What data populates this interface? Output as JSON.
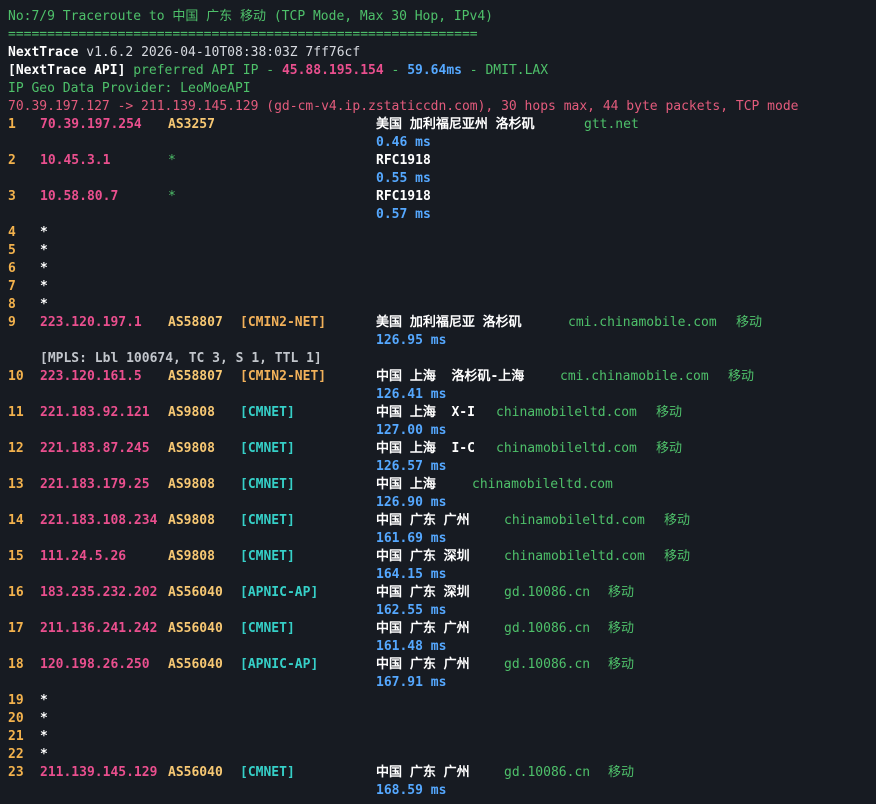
{
  "header": {
    "title": "No:7/9 Traceroute to 中国 广东 移动 (TCP Mode, Max 30 Hop, IPv4)",
    "separator": "============================================================",
    "app_name": "NextTrace",
    "version_info": " v1.6.2 2026-04-10T08:38:03Z 7ff76cf",
    "api_tag": "[NextTrace API]",
    "api_preferred_text": " preferred API IP - ",
    "api_ip": "45.88.195.154",
    "api_dash1": " - ",
    "api_latency": "59.64ms",
    "api_pop": " - DMIT.LAX",
    "geo_provider": "IP Geo Data Provider: LeoMoeAPI",
    "route_summary": "70.39.197.127 -> 211.139.145.129 (gd-cm-v4.ip.zstaticcdn.com), 30 hops max, 44 byte packets, TCP mode"
  },
  "hops": [
    {
      "num": "1",
      "ip": "70.39.197.254",
      "asn": "AS3257",
      "tag": "",
      "geo": "美国 加利福尼亚州 洛杉矶",
      "domain": "gtt.net",
      "isp": "",
      "rtt": "0.46 ms"
    },
    {
      "num": "2",
      "ip": "10.45.3.1",
      "asn": "*",
      "tag": "",
      "geo": "RFC1918",
      "domain": "",
      "isp": "",
      "rtt": "0.55 ms"
    },
    {
      "num": "3",
      "ip": "10.58.80.7",
      "asn": "*",
      "tag": "",
      "geo": "RFC1918",
      "domain": "",
      "isp": "",
      "rtt": "0.57 ms"
    },
    {
      "num": "4",
      "star": "*"
    },
    {
      "num": "5",
      "star": "*"
    },
    {
      "num": "6",
      "star": "*"
    },
    {
      "num": "7",
      "star": "*"
    },
    {
      "num": "8",
      "star": "*"
    },
    {
      "num": "9",
      "ip": "223.120.197.1",
      "asn": "AS58807",
      "tag": "[CMIN2-NET]",
      "geo": "美国 加利福尼亚 洛杉矶",
      "domain": "cmi.chinamobile.com",
      "isp": "移动",
      "rtt": "126.95 ms",
      "mpls": "[MPLS: Lbl 100674, TC 3, S 1, TTL 1]"
    },
    {
      "num": "10",
      "ip": "223.120.161.5",
      "asn": "AS58807",
      "tag": "[CMIN2-NET]",
      "geo": "中国 上海  洛杉矶-上海",
      "domain": "cmi.chinamobile.com",
      "isp": "移动",
      "rtt": "126.41 ms"
    },
    {
      "num": "11",
      "ip": "221.183.92.121",
      "asn": "AS9808",
      "tag": "[CMNET]",
      "geo": "中国 上海  X-I",
      "domain": "chinamobileltd.com",
      "isp": "移动",
      "rtt": "127.00 ms"
    },
    {
      "num": "12",
      "ip": "221.183.87.245",
      "asn": "AS9808",
      "tag": "[CMNET]",
      "geo": "中国 上海  I-C",
      "domain": "chinamobileltd.com",
      "isp": "移动",
      "rtt": "126.57 ms"
    },
    {
      "num": "13",
      "ip": "221.183.179.25",
      "asn": "AS9808",
      "tag": "[CMNET]",
      "geo": "中国 上海",
      "domain": "chinamobileltd.com",
      "isp": "",
      "rtt": "126.90 ms"
    },
    {
      "num": "14",
      "ip": "221.183.108.234",
      "asn": "AS9808",
      "tag": "[CMNET]",
      "geo": "中国 广东 广州",
      "domain": "chinamobileltd.com",
      "isp": "移动",
      "rtt": "161.69 ms"
    },
    {
      "num": "15",
      "ip": "111.24.5.26",
      "asn": "AS9808",
      "tag": "[CMNET]",
      "geo": "中国 广东 深圳",
      "domain": "chinamobileltd.com",
      "isp": "移动",
      "rtt": "164.15 ms"
    },
    {
      "num": "16",
      "ip": "183.235.232.202",
      "asn": "AS56040",
      "tag": "[APNIC-AP]",
      "geo": "中国 广东 深圳",
      "domain": "gd.10086.cn",
      "isp": "移动",
      "rtt": "162.55 ms"
    },
    {
      "num": "17",
      "ip": "211.136.241.242",
      "asn": "AS56040",
      "tag": "[CMNET]",
      "geo": "中国 广东 广州",
      "domain": "gd.10086.cn",
      "isp": "移动",
      "rtt": "161.48 ms"
    },
    {
      "num": "18",
      "ip": "120.198.26.250",
      "asn": "AS56040",
      "tag": "[APNIC-AP]",
      "geo": "中国 广东 广州",
      "domain": "gd.10086.cn",
      "isp": "移动",
      "rtt": "167.91 ms"
    },
    {
      "num": "19",
      "star": "*"
    },
    {
      "num": "20",
      "star": "*"
    },
    {
      "num": "21",
      "star": "*"
    },
    {
      "num": "22",
      "star": "*"
    },
    {
      "num": "23",
      "ip": "211.139.145.129",
      "asn": "AS56040",
      "tag": "[CMNET]",
      "geo": "中国 广东 广州",
      "domain": "gd.10086.cn",
      "isp": "移动",
      "rtt": "168.59 ms"
    }
  ],
  "colors": {
    "background": "#171b22",
    "green": "#4ec06a",
    "ip_pink": "#ea4f8e",
    "rtt_blue": "#55a8ff",
    "tag_orange": "#f2b15a",
    "tag_cyan": "#36d0c8"
  }
}
